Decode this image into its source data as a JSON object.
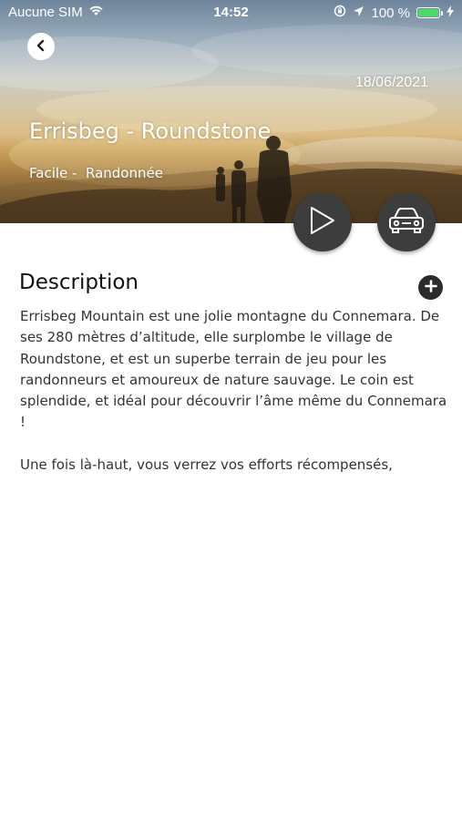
{
  "status_bar": {
    "carrier": "Aucune SIM",
    "time": "14:52",
    "battery_percent": "100 %",
    "battery_level": 1.0,
    "battery_color": "#4cd964",
    "icons": [
      "wifi-icon",
      "orientation-lock-icon",
      "location-arrow-icon",
      "battery-icon",
      "charging-bolt-icon"
    ]
  },
  "header": {
    "back_icon": "chevron-left-icon",
    "date": "18/06/2021",
    "title": "Errisbeg - Roundstone",
    "meta": "Facile -  Randonnée"
  },
  "actions": {
    "play_icon": "play-icon",
    "car_icon": "car-icon",
    "fab_color": "#3d3d3d"
  },
  "description": {
    "heading": "Description",
    "expand_icon": "plus-icon",
    "paragraphs": [
      "Errisbeg Mountain est une jolie montagne du Connemara. De ses 280 mètres d’altitude, elle surplombe le village de Roundstone, et est un superbe terrain de jeu pour les randonneurs et amoureux de nature sauvage. Le coin est splendide, et idéal pour découvrir l’âme même du Connemara !",
      "Une fois là-haut, vous verrez vos efforts récompensés,"
    ]
  }
}
